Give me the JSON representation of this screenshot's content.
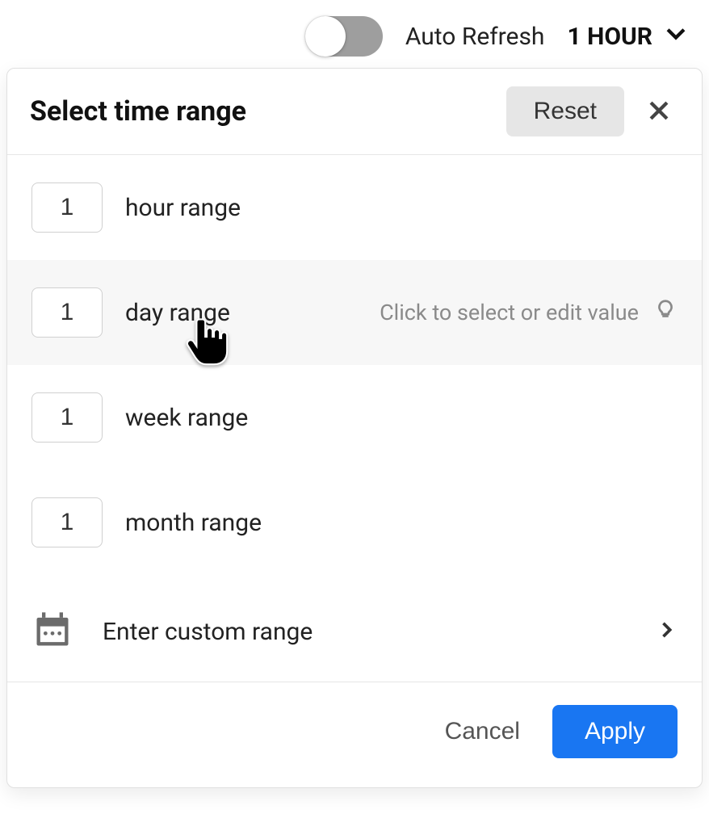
{
  "topbar": {
    "auto_refresh_label": "Auto Refresh",
    "auto_refresh_on": false,
    "current_range": "1 HOUR"
  },
  "dialog": {
    "title": "Select time range",
    "reset_label": "Reset",
    "rows": {
      "hour": {
        "value": "1",
        "label": "hour range"
      },
      "day": {
        "value": "1",
        "label": "day range",
        "hovered": true,
        "hint": "Click to select or edit value"
      },
      "week": {
        "value": "1",
        "label": "week range"
      },
      "month": {
        "value": "1",
        "label": "month range"
      }
    },
    "custom_label": "Enter custom range",
    "cancel_label": "Cancel",
    "apply_label": "Apply"
  }
}
